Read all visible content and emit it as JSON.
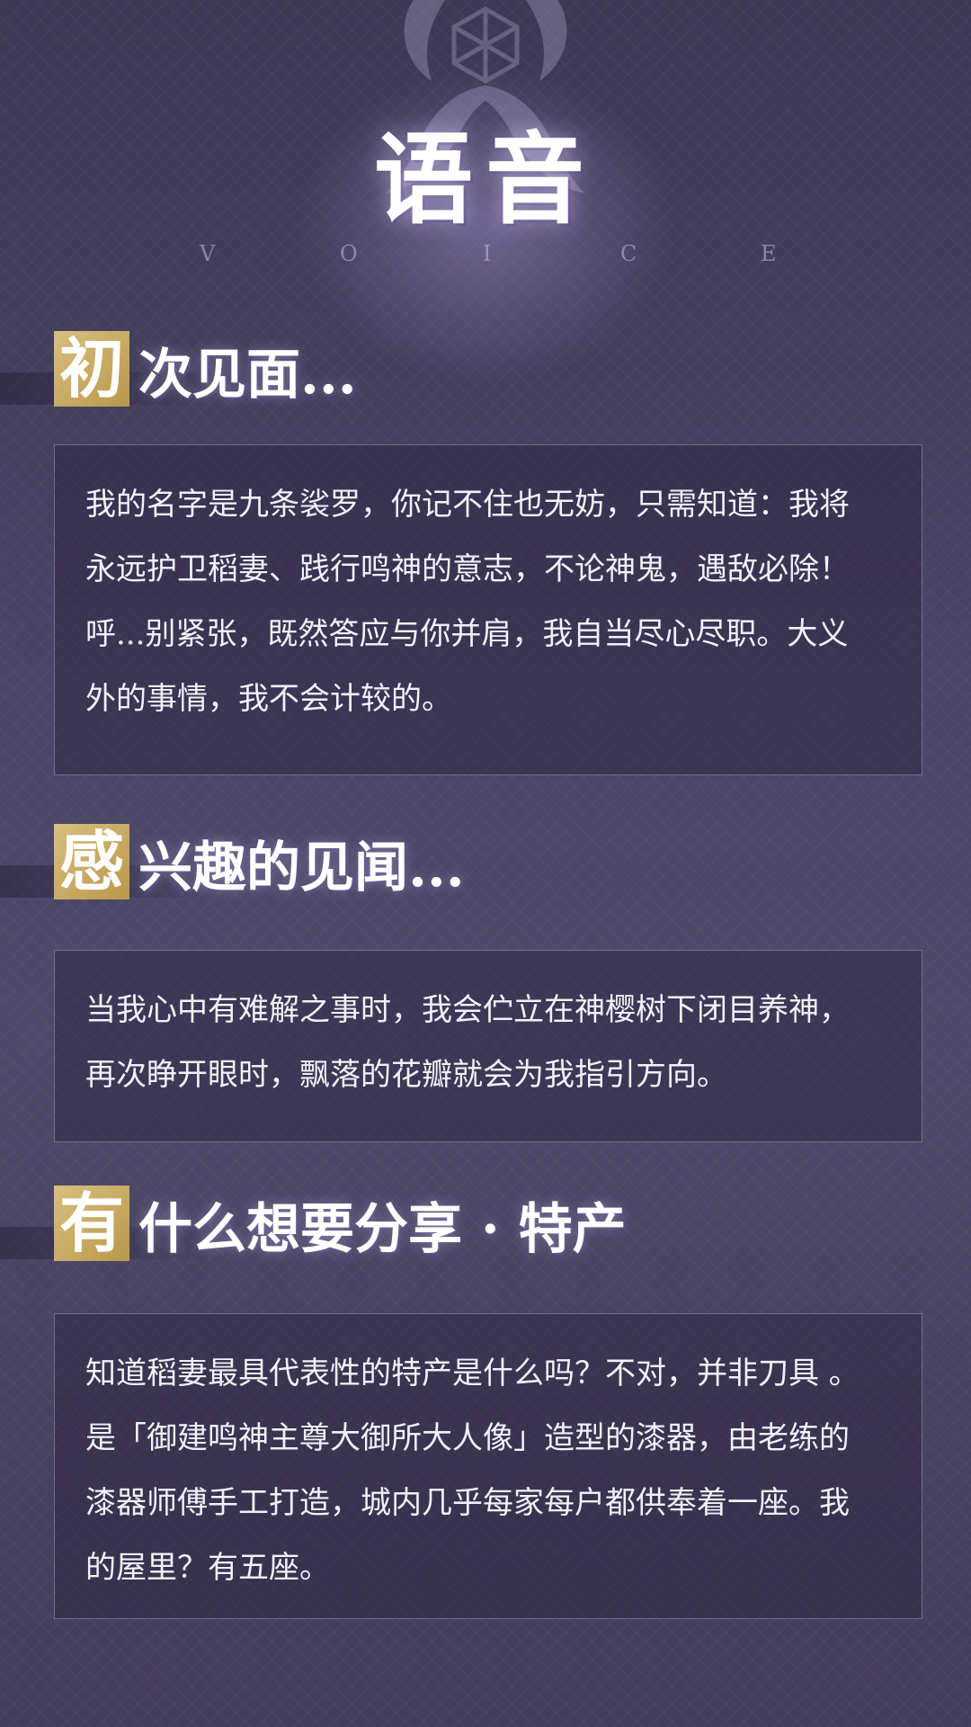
{
  "header": {
    "title": "语音",
    "subtitle_letters": [
      "V",
      "O",
      "I",
      "C",
      "E"
    ]
  },
  "sections": [
    {
      "title_first_char": "初",
      "title_rest": "次见面...",
      "lines": [
        "我的名字是九条裟罗，你记不住也无妨，只需知道：我将",
        "永远护卫稻妻、践行鸣神的意志，不论神鬼，遇敌必除！",
        "呼...别紧张，既然答应与你并肩，我自当尽心尽职。大义",
        "外的事情，我不会计较的。"
      ]
    },
    {
      "title_first_char": "感",
      "title_rest": "兴趣的见闻...",
      "lines": [
        "当我心中有难解之事时，我会伫立在神樱树下闭目养神，",
        "再次睁开眼时，飘落的花瓣就会为我指引方向。"
      ]
    },
    {
      "title_first_char": "有",
      "title_rest": "什么想要分享 · 特产",
      "lines": [
        "知道稻妻最具代表性的特产是什么吗？不对，并非刀具 。",
        "是「御建鸣神主尊大御所大人像」造型的漆器，由老练的",
        "漆器师傅手工打造，城内几乎每家每户都供奉着一座。我",
        "的屋里？有五座。"
      ]
    }
  ],
  "colors": {
    "background": "#4a4466",
    "accent_gold": "#c9ab63",
    "card_border": "#b9afd7",
    "text": "#f3f0fa"
  },
  "icons": {
    "emblem": "inazuma-emblem-icon"
  }
}
